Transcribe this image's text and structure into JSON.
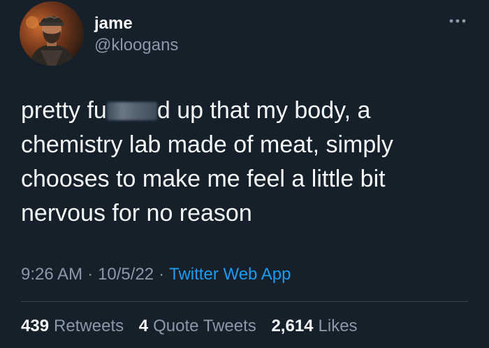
{
  "user": {
    "name": "jame",
    "handle": "@kloogans"
  },
  "tweet": {
    "text_lines": [
      {
        "before": "pretty fu",
        "after": "d up that my body, a"
      },
      "chemistry lab made of meat, simply",
      "chooses to make me feel a little bit",
      "nervous for no reason"
    ]
  },
  "meta": {
    "time": "9:26 AM",
    "date": "10/5/22",
    "separator": "·",
    "source": "Twitter Web App"
  },
  "stats": {
    "retweets": {
      "count": "439",
      "label": "Retweets"
    },
    "quotes": {
      "count": "4",
      "label": "Quote Tweets"
    },
    "likes": {
      "count": "2,614",
      "label": "Likes"
    }
  },
  "icons": {
    "more": "more-horizontal-icon"
  },
  "colors": {
    "background": "#15202b",
    "primary_text": "#f7f9f9",
    "secondary_text": "#8b98a5",
    "link": "#1d9bf0",
    "divider": "#38444d"
  }
}
